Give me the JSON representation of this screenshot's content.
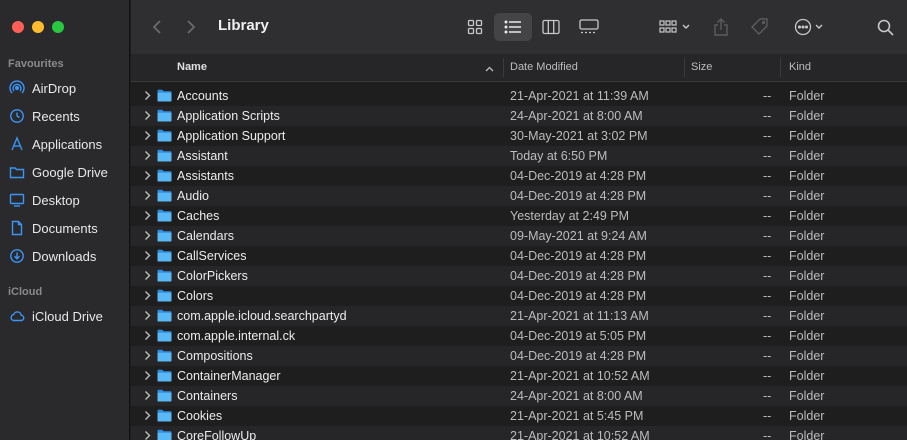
{
  "window": {
    "title": "Library"
  },
  "sidebar": {
    "sections": [
      {
        "label": "Favourites",
        "items": [
          {
            "label": "AirDrop",
            "icon": "airdrop-icon"
          },
          {
            "label": "Recents",
            "icon": "clock-icon"
          },
          {
            "label": "Applications",
            "icon": "applications-icon"
          },
          {
            "label": "Google Drive",
            "icon": "folder-icon"
          },
          {
            "label": "Desktop",
            "icon": "desktop-icon"
          },
          {
            "label": "Documents",
            "icon": "document-icon"
          },
          {
            "label": "Downloads",
            "icon": "download-icon"
          }
        ]
      },
      {
        "label": "iCloud",
        "items": [
          {
            "label": "iCloud Drive",
            "icon": "cloud-icon"
          }
        ]
      }
    ]
  },
  "toolbar": {
    "view_mode": "list",
    "icons": [
      "back-icon",
      "forward-icon",
      "icon-view-icon",
      "list-view-icon",
      "column-view-icon",
      "gallery-view-icon",
      "group-icon",
      "share-icon",
      "tag-icon",
      "more-icon",
      "search-icon"
    ]
  },
  "columns": {
    "name": "Name",
    "date": "Date Modified",
    "size": "Size",
    "kind": "Kind"
  },
  "rows": [
    {
      "name": "Accounts",
      "date": "21-Apr-2021 at 11:39 AM",
      "size": "--",
      "kind": "Folder"
    },
    {
      "name": "Application Scripts",
      "date": "24-Apr-2021 at 8:00 AM",
      "size": "--",
      "kind": "Folder"
    },
    {
      "name": "Application Support",
      "date": "30-May-2021 at 3:02 PM",
      "size": "--",
      "kind": "Folder"
    },
    {
      "name": "Assistant",
      "date": "Today at 6:50 PM",
      "size": "--",
      "kind": "Folder"
    },
    {
      "name": "Assistants",
      "date": "04-Dec-2019 at 4:28 PM",
      "size": "--",
      "kind": "Folder"
    },
    {
      "name": "Audio",
      "date": "04-Dec-2019 at 4:28 PM",
      "size": "--",
      "kind": "Folder"
    },
    {
      "name": "Caches",
      "date": "Yesterday at 2:49 PM",
      "size": "--",
      "kind": "Folder"
    },
    {
      "name": "Calendars",
      "date": "09-May-2021 at 9:24 AM",
      "size": "--",
      "kind": "Folder"
    },
    {
      "name": "CallServices",
      "date": "04-Dec-2019 at 4:28 PM",
      "size": "--",
      "kind": "Folder"
    },
    {
      "name": "ColorPickers",
      "date": "04-Dec-2019 at 4:28 PM",
      "size": "--",
      "kind": "Folder"
    },
    {
      "name": "Colors",
      "date": "04-Dec-2019 at 4:28 PM",
      "size": "--",
      "kind": "Folder"
    },
    {
      "name": "com.apple.icloud.searchpartyd",
      "date": "21-Apr-2021 at 11:13 AM",
      "size": "--",
      "kind": "Folder"
    },
    {
      "name": "com.apple.internal.ck",
      "date": "04-Dec-2019 at 5:05 PM",
      "size": "--",
      "kind": "Folder"
    },
    {
      "name": "Compositions",
      "date": "04-Dec-2019 at 4:28 PM",
      "size": "--",
      "kind": "Folder"
    },
    {
      "name": "ContainerManager",
      "date": "21-Apr-2021 at 10:52 AM",
      "size": "--",
      "kind": "Folder"
    },
    {
      "name": "Containers",
      "date": "24-Apr-2021 at 8:00 AM",
      "size": "--",
      "kind": "Folder"
    },
    {
      "name": "Cookies",
      "date": "21-Apr-2021 at 5:45 PM",
      "size": "--",
      "kind": "Folder"
    },
    {
      "name": "CoreFollowUp",
      "date": "21-Apr-2021 at 10:52 AM",
      "size": "--",
      "kind": "Folder"
    }
  ],
  "colors": {
    "accent": "#2f8cf5",
    "folder": "#3fa9f5",
    "sidebar_bg": "#2a2a2c",
    "list_bg": "#1e1e1e"
  }
}
